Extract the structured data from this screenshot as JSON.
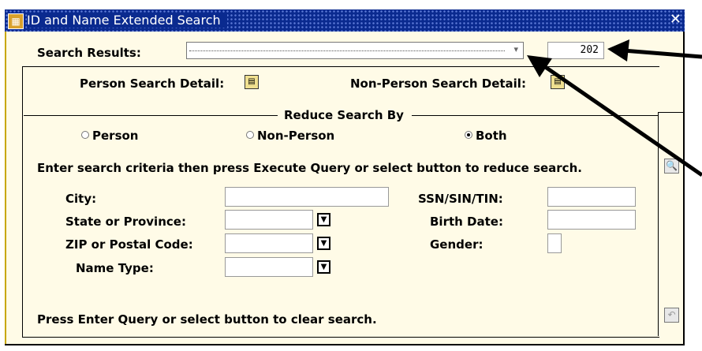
{
  "window": {
    "title": "ID and Name Extended Search",
    "close_icon": "close-x-icon",
    "app_icon": "banner-app-icon"
  },
  "search_results": {
    "label": "Search Results:",
    "value": "",
    "count": "202"
  },
  "details": {
    "person_label": "Person Search Detail:",
    "nonperson_label": "Non-Person Search Detail:"
  },
  "reduce": {
    "heading": "Reduce Search By",
    "options": [
      "Person",
      "Non-Person",
      "Both"
    ],
    "selected": "Both"
  },
  "instruction": "Enter search criteria then press Execute Query or select button to reduce search.",
  "fields_left": {
    "city": "City:",
    "state": "State or Province:",
    "zip": "ZIP or Postal Code:",
    "name_type": "Name Type:"
  },
  "fields_right": {
    "ssn": "SSN/SIN/TIN:",
    "birth": "Birth Date:",
    "gender": "Gender:"
  },
  "footer": "Press Enter Query or select button to clear search.",
  "colors": {
    "title_bg": "#0a2a8f",
    "window_bg": "#fffbe7",
    "accent": "#d9a12c"
  }
}
